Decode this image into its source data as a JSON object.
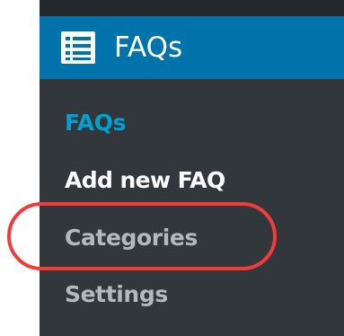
{
  "menu": {
    "header": {
      "label": "FAQs",
      "icon": "list-icon"
    },
    "items": [
      {
        "label": "FAQs",
        "state": "current"
      },
      {
        "label": "Add new FAQ",
        "state": "hover"
      },
      {
        "label": "Categories",
        "state": "highlighted"
      },
      {
        "label": "Settings",
        "state": "normal"
      }
    ]
  },
  "colors": {
    "sidebar_bg": "#23282d",
    "submenu_bg": "#32373c",
    "header_bg": "#0073aa",
    "current_item": "#00a0d2",
    "item_text": "#b4b9be",
    "hover_item": "#ffffff",
    "highlight_ring": "#f23c3c"
  }
}
